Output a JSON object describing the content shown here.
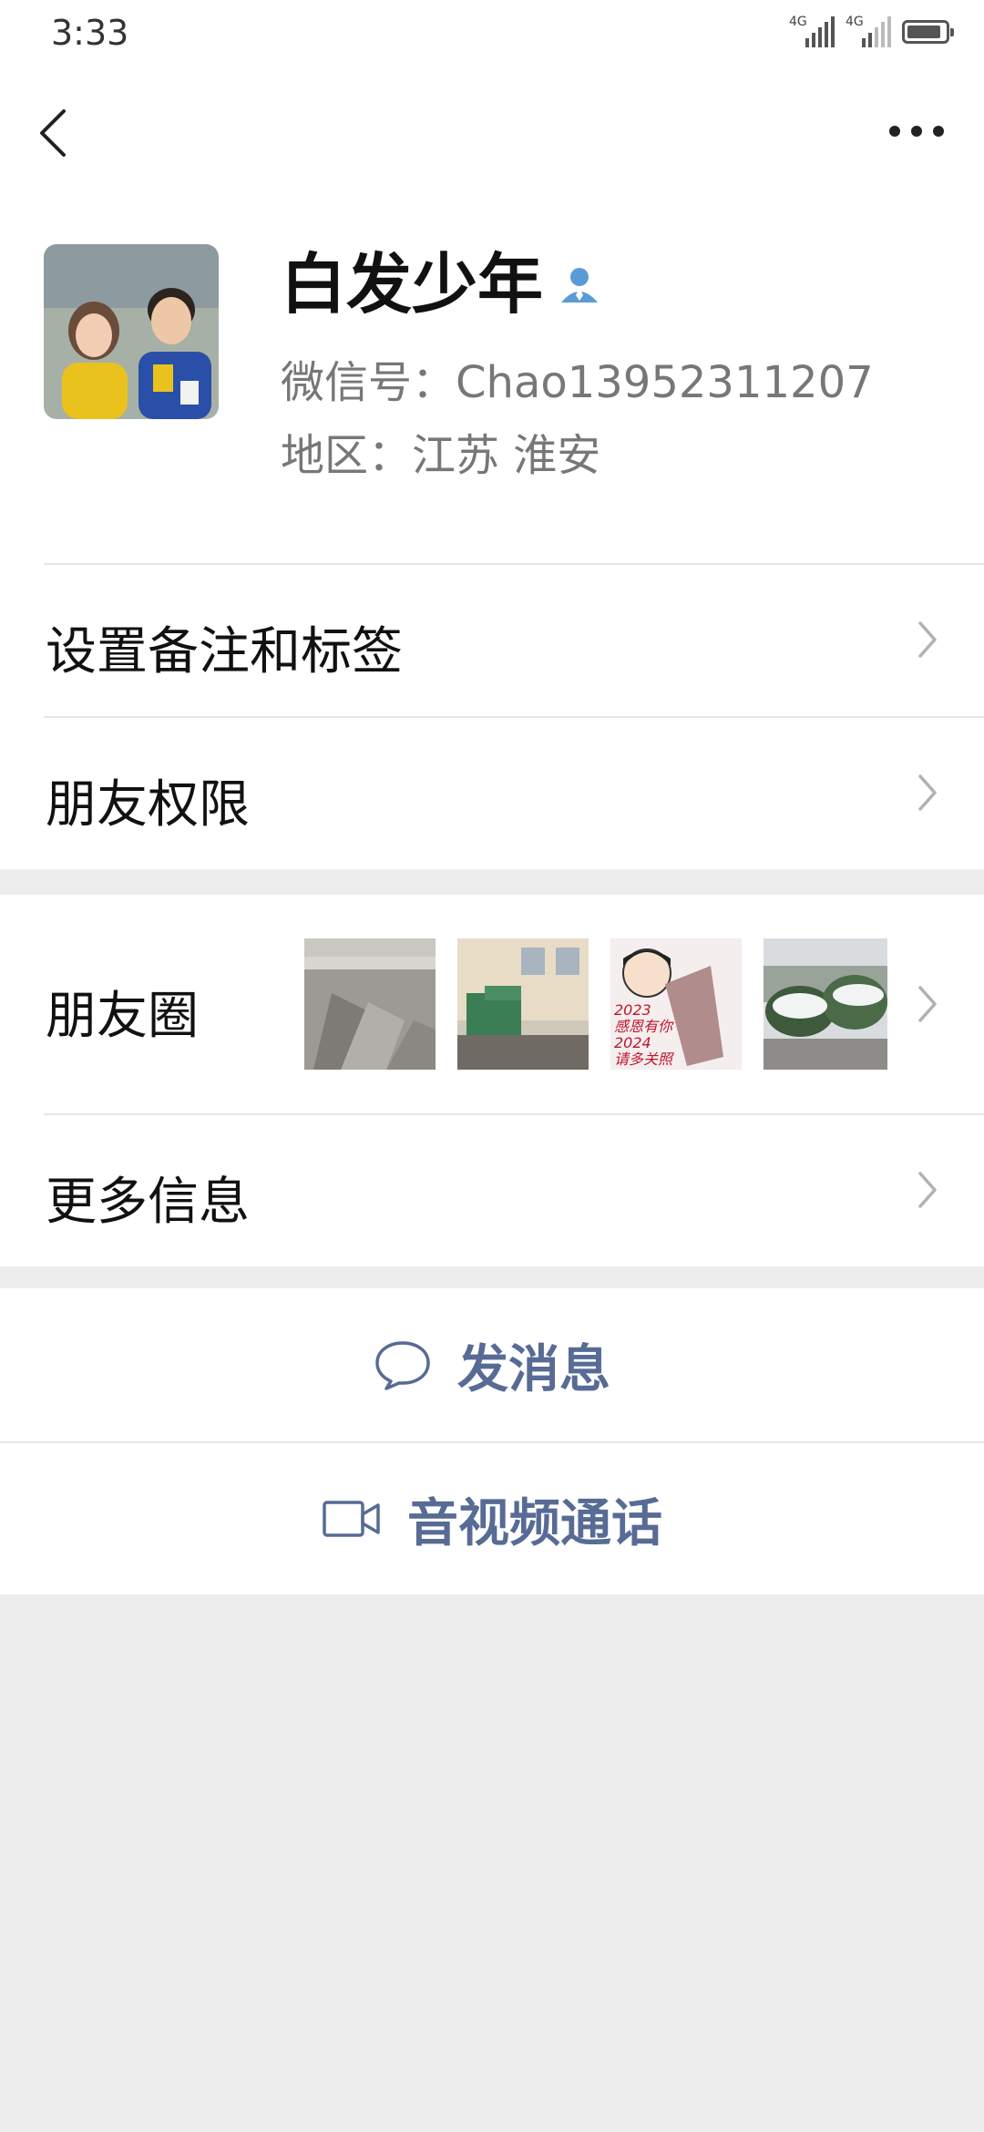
{
  "status_bar": {
    "time": "3:33",
    "network_1": "4G",
    "network_2": "4G"
  },
  "nav": {
    "back_icon": "chevron-left-icon",
    "more_icon": "more-horizontal-icon"
  },
  "profile": {
    "name": "白发少年",
    "name_badge_icon": "person-icon",
    "wechat_id": "微信号：Chao13952311207",
    "region": "地区：江苏  淮安"
  },
  "menu": {
    "remark_label": "设置备注和标签",
    "permission_label": "朋友权限",
    "moments_label": "朋友圈",
    "more_info_label": "更多信息"
  },
  "moments_thumbs": {
    "thumb3_line1": "2023",
    "thumb3_line2": "感恩有你",
    "thumb3_line3": "2024",
    "thumb3_line4": "请多关照"
  },
  "actions": {
    "message_label": "发消息",
    "message_icon": "chat-bubble-icon",
    "call_label": "音视频通话",
    "call_icon": "video-camera-icon"
  },
  "colors": {
    "link_blue": "#576b95",
    "badge_blue": "#5b9bd5",
    "background": "#ededed"
  }
}
